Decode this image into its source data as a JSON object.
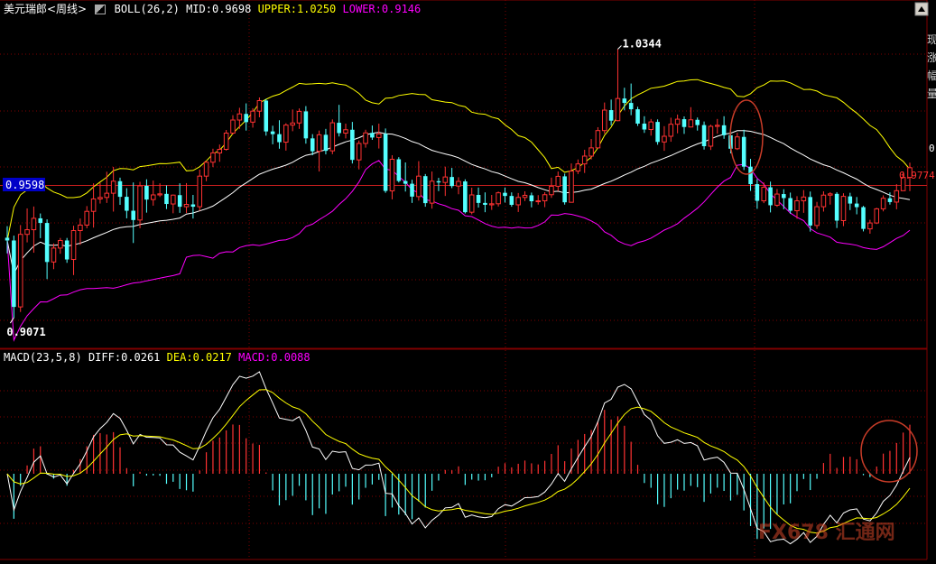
{
  "header": {
    "symbol": "美元瑞郎<周线>",
    "indicator": "BOLL(26,2)",
    "mid_label": "MID:",
    "mid_value": "0.9698",
    "upper_label": "UPPER:",
    "upper_value": "1.0250",
    "lower_label": "LOWER:",
    "lower_value": "0.9146"
  },
  "macd_header": {
    "indicator": "MACD(23,5,8)",
    "diff_label": "DIFF:",
    "diff_value": "0.0261",
    "dea_label": "DEA:",
    "dea_value": "0.0217",
    "macd_label": "MACD:",
    "macd_value": "0.0088"
  },
  "annotations": {
    "high_label": "1.0344",
    "low_label": "0.9071",
    "left_box_label": "0.9598",
    "right_price_label": "0.9774",
    "right_edge_digit": "0"
  },
  "watermark": "FX678 汇通网",
  "side_text": [
    "现",
    "涨",
    "幅",
    "量"
  ],
  "colors": {
    "background": "#000000",
    "up": "#ff3232",
    "down": "#54ffff",
    "mid": "#ffffff",
    "upper": "#ffff00",
    "lower": "#ff00ff",
    "diff": "#ffffff",
    "dea": "#ffff00",
    "hline": "#c81e1e",
    "grid": "#800000",
    "box": "#0000c8",
    "circle": "#c83c28"
  },
  "chart_data": [
    {
      "type": "candlestick",
      "title": "美元瑞郎<周线>",
      "x_unit": "week",
      "ylim": [
        0.893,
        1.05
      ],
      "horizontal_line": 0.9698,
      "candles": [
        [
          0.945,
          0.9505,
          0.9376,
          0.9437
        ],
        [
          0.9437,
          0.946,
          0.9071,
          0.9122
        ],
        [
          0.9122,
          0.951,
          0.9098,
          0.9466
        ],
        [
          0.9466,
          0.9589,
          0.9428,
          0.9488
        ],
        [
          0.9488,
          0.9598,
          0.9379,
          0.9542
        ],
        [
          0.9542,
          0.9565,
          0.9448,
          0.952
        ],
        [
          0.952,
          0.9537,
          0.9254,
          0.9335
        ],
        [
          0.9335,
          0.9423,
          0.9301,
          0.9401
        ],
        [
          0.9401,
          0.9449,
          0.9374,
          0.9437
        ],
        [
          0.9437,
          0.9449,
          0.9331,
          0.9347
        ],
        [
          0.9347,
          0.9507,
          0.9273,
          0.9484
        ],
        [
          0.9484,
          0.9541,
          0.9416,
          0.951
        ],
        [
          0.951,
          0.96,
          0.9495,
          0.9575
        ],
        [
          0.9575,
          0.9708,
          0.9498,
          0.9634
        ],
        [
          0.9634,
          0.971,
          0.9612,
          0.9641
        ],
        [
          0.9641,
          0.9763,
          0.9615,
          0.9661
        ],
        [
          0.9661,
          0.9786,
          0.9574,
          0.9718
        ],
        [
          0.9718,
          0.9735,
          0.9606,
          0.9644
        ],
        [
          0.9644,
          0.9685,
          0.9542,
          0.9578
        ],
        [
          0.9578,
          0.9712,
          0.9425,
          0.9534
        ],
        [
          0.9534,
          0.9715,
          0.9495,
          0.9696
        ],
        [
          0.9696,
          0.9727,
          0.9569,
          0.9631
        ],
        [
          0.9631,
          0.9721,
          0.9602,
          0.9653
        ],
        [
          0.9653,
          0.9708,
          0.9643,
          0.9658
        ],
        [
          0.9658,
          0.9698,
          0.9586,
          0.961
        ],
        [
          0.961,
          0.9655,
          0.9566,
          0.9652
        ],
        [
          0.9652,
          0.9708,
          0.9568,
          0.9597
        ],
        [
          0.9597,
          0.9709,
          0.9567,
          0.9608
        ],
        [
          0.9608,
          0.9653,
          0.9541,
          0.9597
        ],
        [
          0.9597,
          0.9773,
          0.9578,
          0.9742
        ],
        [
          0.9742,
          0.9815,
          0.9718,
          0.9808
        ],
        [
          0.9808,
          0.9872,
          0.9785,
          0.9852
        ],
        [
          0.9852,
          0.9892,
          0.981,
          0.9869
        ],
        [
          0.9869,
          0.9961,
          0.9863,
          0.9946
        ],
        [
          0.9946,
          1.0031,
          0.9939,
          1.0008
        ],
        [
          1.0008,
          1.0066,
          0.9966,
          1.0037
        ],
        [
          1.0037,
          1.0087,
          0.9958,
          0.9998
        ],
        [
          0.9998,
          1.0064,
          0.9972,
          1.005
        ],
        [
          1.005,
          1.0115,
          1.0021,
          1.01
        ],
        [
          1.01,
          1.0108,
          0.9934,
          0.9954
        ],
        [
          0.9954,
          0.9981,
          0.9893,
          0.9941
        ],
        [
          0.9941,
          1.0007,
          0.9872,
          0.9903
        ],
        [
          0.9903,
          0.9993,
          0.9863,
          0.9984
        ],
        [
          0.9984,
          1.0058,
          0.9955,
          0.9994
        ],
        [
          0.9994,
          1.0063,
          0.9966,
          1.0049
        ],
        [
          1.0049,
          1.0074,
          0.9896,
          0.9921
        ],
        [
          0.9921,
          0.9941,
          0.9841,
          0.986
        ],
        [
          0.986,
          0.9958,
          0.9764,
          0.9938
        ],
        [
          0.9938,
          0.9966,
          0.9845,
          0.9862
        ],
        [
          0.9862,
          1.0011,
          0.9846,
          0.9995
        ],
        [
          0.9995,
          1.008,
          0.993,
          0.9946
        ],
        [
          0.9946,
          0.9991,
          0.9921,
          0.9962
        ],
        [
          0.9962,
          0.9999,
          0.9802,
          0.9819
        ],
        [
          0.9819,
          0.9911,
          0.9774,
          0.9897
        ],
        [
          0.9897,
          0.9962,
          0.9877,
          0.9947
        ],
        [
          0.9947,
          0.9982,
          0.9914,
          0.9925
        ],
        [
          0.9925,
          0.9991,
          0.9873,
          0.9942
        ],
        [
          0.9942,
          0.9968,
          0.9663,
          0.9672
        ],
        [
          0.9672,
          0.9841,
          0.9632,
          0.9822
        ],
        [
          0.9822,
          0.9832,
          0.9712,
          0.9719
        ],
        [
          0.9719,
          0.9807,
          0.9669,
          0.9706
        ],
        [
          0.9706,
          0.9725,
          0.9615,
          0.9645
        ],
        [
          0.9645,
          0.9813,
          0.9626,
          0.9742
        ],
        [
          0.9742,
          0.9752,
          0.9597,
          0.9614
        ],
        [
          0.9614,
          0.9764,
          0.9588,
          0.9718
        ],
        [
          0.9718,
          0.9734,
          0.9671,
          0.9712
        ],
        [
          0.9712,
          0.9787,
          0.9648,
          0.9738
        ],
        [
          0.9738,
          0.9781,
          0.9685,
          0.9695
        ],
        [
          0.9695,
          0.9737,
          0.9656,
          0.9717
        ],
        [
          0.9717,
          0.9727,
          0.9565,
          0.9571
        ],
        [
          0.9571,
          0.9687,
          0.9561,
          0.9653
        ],
        [
          0.9653,
          0.9688,
          0.9593,
          0.9615
        ],
        [
          0.9615,
          0.9665,
          0.9571,
          0.9606
        ],
        [
          0.9606,
          0.9653,
          0.9582,
          0.9611
        ],
        [
          0.9611,
          0.9669,
          0.9598,
          0.9663
        ],
        [
          0.9663,
          0.9688,
          0.9617,
          0.9648
        ],
        [
          0.9648,
          0.9665,
          0.9597,
          0.9606
        ],
        [
          0.9606,
          0.9662,
          0.9572,
          0.9641
        ],
        [
          0.9641,
          0.967,
          0.9624,
          0.9651
        ],
        [
          0.9651,
          0.9664,
          0.9594,
          0.9623
        ],
        [
          0.9623,
          0.9652,
          0.9607,
          0.9625
        ],
        [
          0.9625,
          0.9666,
          0.9595,
          0.9654
        ],
        [
          0.9654,
          0.9735,
          0.9639,
          0.9694
        ],
        [
          0.9694,
          0.9764,
          0.9671,
          0.9741
        ],
        [
          0.9741,
          0.9754,
          0.9607,
          0.9618
        ],
        [
          0.9618,
          0.9802,
          0.9618,
          0.9766
        ],
        [
          0.9766,
          0.9821,
          0.9752,
          0.98
        ],
        [
          0.98,
          0.9867,
          0.9757,
          0.9837
        ],
        [
          0.9837,
          0.9918,
          0.9821,
          0.9876
        ],
        [
          0.9876,
          0.9974,
          0.9876,
          0.9958
        ],
        [
          0.9958,
          1.0091,
          0.9943,
          1.0055
        ],
        [
          1.0055,
          1.0105,
          0.9983,
          1.0005
        ],
        [
          1.0005,
          1.0344,
          1.0002,
          1.011
        ],
        [
          1.011,
          1.0161,
          1.0054,
          1.0089
        ],
        [
          1.0089,
          1.0181,
          1.0031,
          1.0059
        ],
        [
          1.0059,
          1.0071,
          0.998,
          0.9991
        ],
        [
          0.9991,
          1.0026,
          0.9947,
          0.9963
        ],
        [
          0.9963,
          1.0013,
          0.9934,
          0.9999
        ],
        [
          0.9999,
          1.0011,
          0.9891,
          0.9904
        ],
        [
          0.9904,
          0.9979,
          0.9862,
          0.9931
        ],
        [
          0.9931,
          1.0019,
          0.9905,
          0.9988
        ],
        [
          0.9988,
          1.0034,
          0.9945,
          1.0012
        ],
        [
          1.0012,
          1.0025,
          0.9942,
          0.9975
        ],
        [
          0.9975,
          1.0069,
          0.9973,
          1.0009
        ],
        [
          1.0009,
          1.002,
          0.9958,
          0.9984
        ],
        [
          0.9984,
          1.0001,
          0.9868,
          0.9884
        ],
        [
          0.9884,
          0.9986,
          0.9866,
          0.9978
        ],
        [
          0.9978,
          1.0013,
          0.9943,
          0.9983
        ],
        [
          0.9983,
          1.0026,
          0.9919,
          0.9936
        ],
        [
          0.9936,
          0.9957,
          0.985,
          0.9872
        ],
        [
          0.9872,
          0.9948,
          0.9866,
          0.9928
        ],
        [
          0.9928,
          0.9962,
          0.9771,
          0.9787
        ],
        [
          0.9787,
          0.9824,
          0.9672,
          0.9704
        ],
        [
          0.9704,
          0.9728,
          0.9587,
          0.9625
        ],
        [
          0.9625,
          0.9712,
          0.9614,
          0.9689
        ],
        [
          0.9689,
          0.9716,
          0.957,
          0.9604
        ],
        [
          0.9604,
          0.9681,
          0.9596,
          0.9657
        ],
        [
          0.9657,
          0.968,
          0.9585,
          0.9638
        ],
        [
          0.9638,
          0.9664,
          0.9564,
          0.9578
        ],
        [
          0.9578,
          0.9647,
          0.954,
          0.9625
        ],
        [
          0.9625,
          0.9676,
          0.9568,
          0.9643
        ],
        [
          0.9643,
          0.9669,
          0.9479,
          0.9508
        ],
        [
          0.9508,
          0.962,
          0.9492,
          0.9597
        ],
        [
          0.9597,
          0.967,
          0.9574,
          0.9652
        ],
        [
          0.9652,
          0.9666,
          0.9607,
          0.9658
        ],
        [
          0.9658,
          0.9666,
          0.9496,
          0.9531
        ],
        [
          0.9531,
          0.9661,
          0.9505,
          0.9646
        ],
        [
          0.9646,
          0.9663,
          0.9581,
          0.9612
        ],
        [
          0.9612,
          0.9643,
          0.9561,
          0.9595
        ],
        [
          0.9595,
          0.9601,
          0.948,
          0.9492
        ],
        [
          0.9492,
          0.9535,
          0.9469,
          0.952
        ],
        [
          0.952,
          0.9592,
          0.9515,
          0.9587
        ],
        [
          0.9587,
          0.9651,
          0.9575,
          0.9637
        ],
        [
          0.9637,
          0.9665,
          0.9607,
          0.9619
        ],
        [
          0.9619,
          0.9704,
          0.9585,
          0.9673
        ],
        [
          0.9673,
          0.9764,
          0.9673,
          0.9736
        ],
        [
          0.9736,
          0.9806,
          0.9671,
          0.9782
        ]
      ],
      "bollinger": {
        "period": 26,
        "k": 2,
        "mid": 0.9698,
        "upper": 1.025,
        "lower": 0.9146
      }
    },
    {
      "type": "macd",
      "title": "MACD(23,5,8)",
      "params": [
        23,
        5,
        8
      ],
      "diff": 0.0261,
      "dea": 0.0217,
      "macd": 0.0088
    }
  ]
}
